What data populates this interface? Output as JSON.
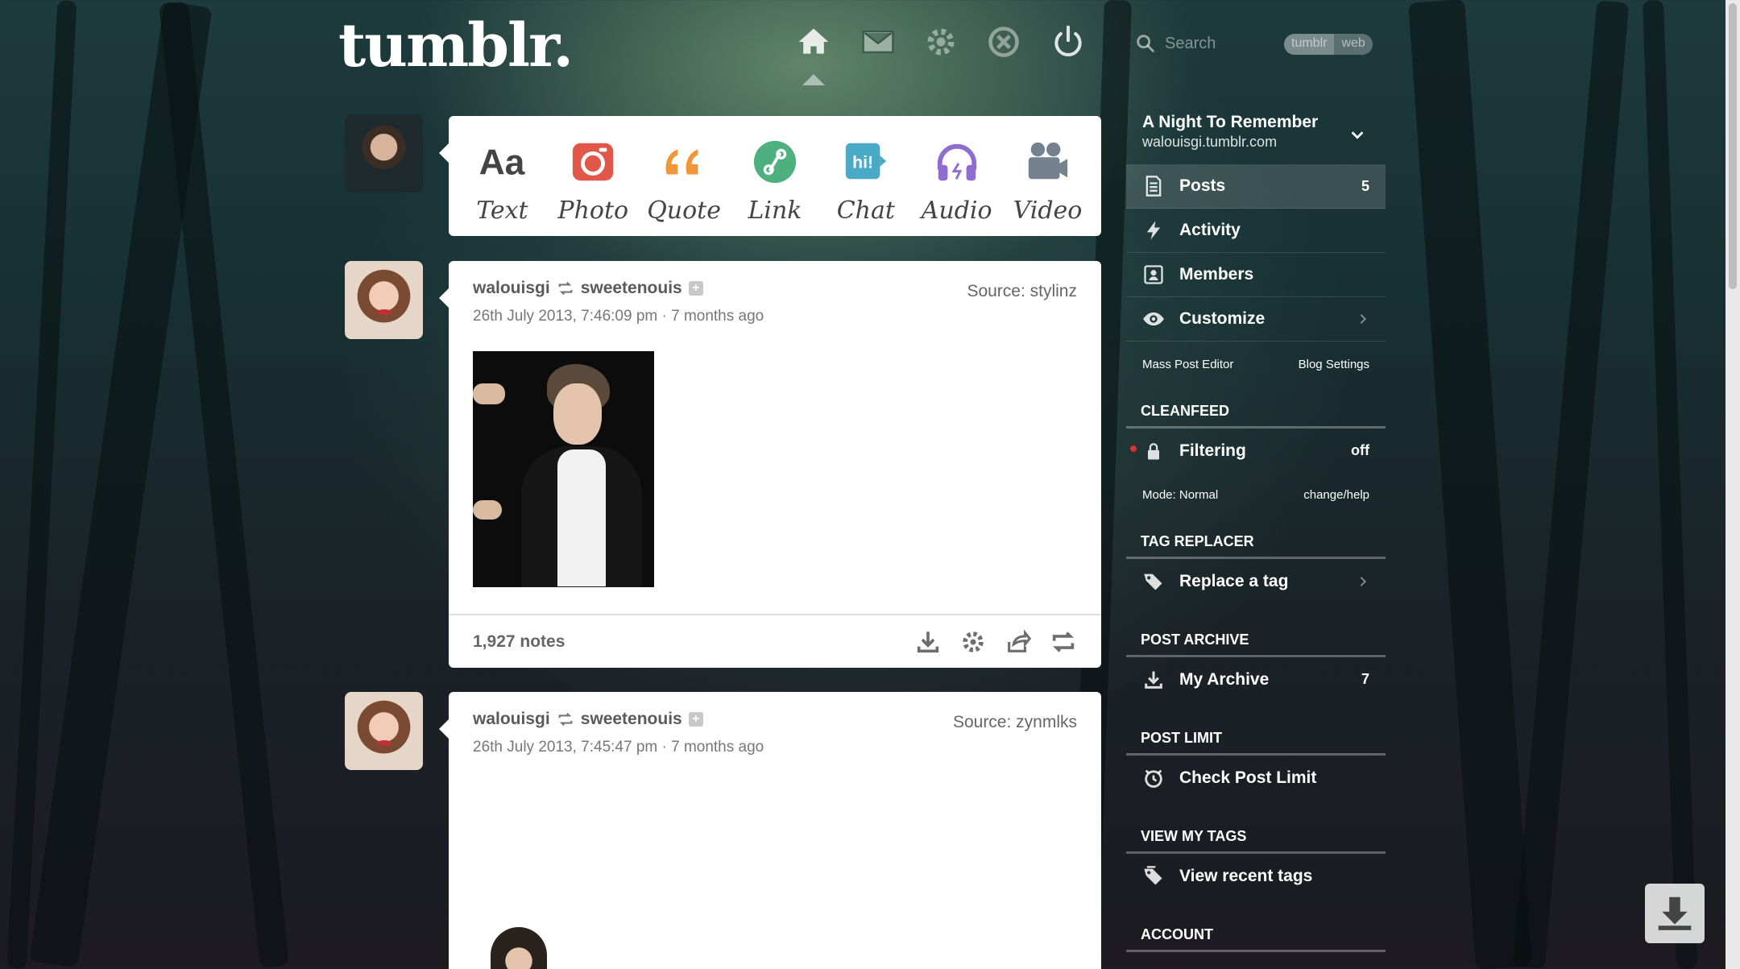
{
  "header": {
    "logo": "tumblr.",
    "search_placeholder": "Search",
    "search_scope": [
      "tumblr",
      "web"
    ]
  },
  "composer": {
    "types": [
      {
        "label": "Text",
        "icon": "text-icon",
        "color": "#444444"
      },
      {
        "label": "Photo",
        "icon": "photo-icon",
        "color": "#e1584b"
      },
      {
        "label": "Quote",
        "icon": "quote-icon",
        "color": "#f0963a"
      },
      {
        "label": "Link",
        "icon": "link-icon",
        "color": "#4eb07f"
      },
      {
        "label": "Chat",
        "icon": "chat-icon",
        "color": "#4aa9c4"
      },
      {
        "label": "Audio",
        "icon": "audio-icon",
        "color": "#8f6dd0"
      },
      {
        "label": "Video",
        "icon": "video-icon",
        "color": "#74818f"
      }
    ]
  },
  "posts": [
    {
      "author": "walouisgi",
      "reblogged_from": "sweetenouis",
      "date": "26th July 2013, 7:46:09 pm · 7 months ago",
      "source": "Source: stylinz",
      "notes": "1,927 notes"
    },
    {
      "author": "walouisgi",
      "reblogged_from": "sweetenouis",
      "date": "26th July 2013, 7:45:47 pm · 7 months ago",
      "source": "Source: zynmlks"
    }
  ],
  "sidebar": {
    "blog_title": "A Night To Remember",
    "blog_url": "walouisgi.tumblr.com",
    "menu": [
      {
        "label": "Posts",
        "value": "5"
      },
      {
        "label": "Activity",
        "value": ""
      },
      {
        "label": "Members",
        "value": ""
      },
      {
        "label": "Customize",
        "value": ""
      }
    ],
    "mass_post_editor": "Mass Post Editor",
    "blog_settings": "Blog Settings",
    "cleanfeed": {
      "title": "CLEANFEED",
      "filtering_label": "Filtering",
      "filtering_value": "off",
      "mode": "Mode: Normal",
      "change_help": "change/help"
    },
    "tag_replacer": {
      "title": "TAG REPLACER",
      "label": "Replace a tag"
    },
    "post_archive": {
      "title": "POST ARCHIVE",
      "label": "My Archive",
      "value": "7"
    },
    "post_limit": {
      "title": "POST LIMIT",
      "label": "Check Post Limit"
    },
    "view_my_tags": {
      "title": "VIEW MY TAGS",
      "label": "View recent tags"
    },
    "account": {
      "title": "ACCOUNT"
    }
  }
}
